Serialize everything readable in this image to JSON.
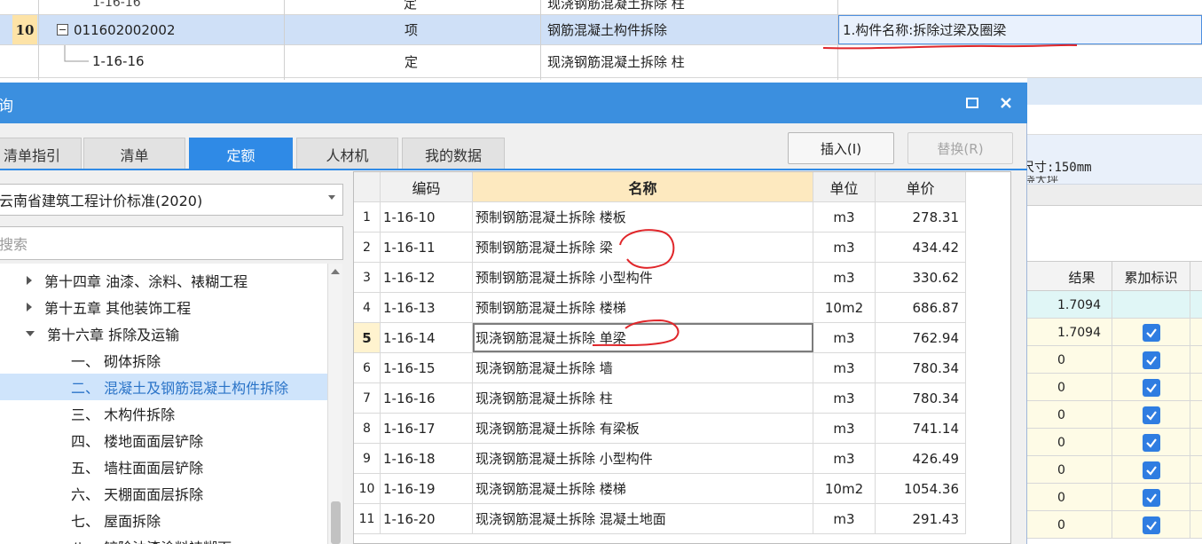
{
  "background_sheet": {
    "row_cut": {
      "code": "1-16-16",
      "type": "定",
      "name": "现浇钢筋混凝土拆除 柱"
    },
    "row_10": {
      "num": "10",
      "code": "011602002002",
      "type": "项",
      "name": "钢筋混凝土构件拆除",
      "feature": "1.构件名称:拆除过梁及圈梁"
    },
    "row_sub": {
      "code": "1-16-16",
      "type": "定",
      "name": "现浇钢筋混凝土拆除 柱"
    },
    "side_text": "尺寸:150mm",
    "side_text_cut": "浇大坪",
    "result_headers": [
      "结果",
      "累加标识"
    ],
    "result_rows": [
      {
        "result": "1.7094",
        "checked": false
      },
      {
        "result": "1.7094",
        "checked": true
      },
      {
        "result": "0",
        "checked": true
      },
      {
        "result": "0",
        "checked": true
      },
      {
        "result": "0",
        "checked": true
      },
      {
        "result": "0",
        "checked": true
      },
      {
        "result": "0",
        "checked": true
      },
      {
        "result": "0",
        "checked": true
      },
      {
        "result": "0",
        "checked": true
      }
    ]
  },
  "dialog": {
    "title": "询",
    "tabs": [
      "清单指引",
      "清单",
      "定额",
      "人材机",
      "我的数据"
    ],
    "active_tab": "定额",
    "buttons": {
      "insert": "插入(I)",
      "replace": "替换(R)"
    },
    "standard_select": "云南省建筑工程计价标准(2020)",
    "search_placeholder": "搜索",
    "tree": [
      {
        "label": "第十四章 油漆、涂料、裱糊工程",
        "state": "collapsed"
      },
      {
        "label": "第十五章 其他装饰工程",
        "state": "collapsed"
      },
      {
        "label": "第十六章 拆除及运输",
        "state": "expanded"
      },
      {
        "label": "一、 砌体拆除"
      },
      {
        "label": "二、 混凝土及钢筋混凝土构件拆除",
        "selected": true
      },
      {
        "label": "三、 木构件拆除"
      },
      {
        "label": "四、 楼地面面层铲除"
      },
      {
        "label": "五、 墙柱面面层铲除"
      },
      {
        "label": "六、 天棚面面层拆除"
      },
      {
        "label": "七、 屋面拆除"
      },
      {
        "label": "八、 铲除油漆涂料裱糊面"
      }
    ],
    "grid": {
      "headers": {
        "code": "编码",
        "name": "名称",
        "unit": "单位",
        "price": "单价"
      },
      "rows": [
        {
          "num": "1",
          "code": "1-16-10",
          "name": "预制钢筋混凝土拆除 楼板",
          "unit": "m3",
          "price": "278.31"
        },
        {
          "num": "2",
          "code": "1-16-11",
          "name": "预制钢筋混凝土拆除 梁",
          "unit": "m3",
          "price": "434.42"
        },
        {
          "num": "3",
          "code": "1-16-12",
          "name": "预制钢筋混凝土拆除 小型构件",
          "unit": "m3",
          "price": "330.62"
        },
        {
          "num": "4",
          "code": "1-16-13",
          "name": "预制钢筋混凝土拆除 楼梯",
          "unit": "10m2",
          "price": "686.87"
        },
        {
          "num": "5",
          "code": "1-16-14",
          "name": "现浇钢筋混凝土拆除 单梁",
          "unit": "m3",
          "price": "762.94",
          "current": true
        },
        {
          "num": "6",
          "code": "1-16-15",
          "name": "现浇钢筋混凝土拆除 墙",
          "unit": "m3",
          "price": "780.34"
        },
        {
          "num": "7",
          "code": "1-16-16",
          "name": "现浇钢筋混凝土拆除 柱",
          "unit": "m3",
          "price": "780.34"
        },
        {
          "num": "8",
          "code": "1-16-17",
          "name": "现浇钢筋混凝土拆除 有梁板",
          "unit": "m3",
          "price": "741.14"
        },
        {
          "num": "9",
          "code": "1-16-18",
          "name": "现浇钢筋混凝土拆除 小型构件",
          "unit": "m3",
          "price": "426.49"
        },
        {
          "num": "10",
          "code": "1-16-19",
          "name": "现浇钢筋混凝土拆除 楼梯",
          "unit": "10m2",
          "price": "1054.36"
        },
        {
          "num": "11",
          "code": "1-16-20",
          "name": "现浇钢筋混凝土拆除 混凝土地面",
          "unit": "m3",
          "price": "291.43"
        }
      ]
    }
  },
  "colors": {
    "titlebar": "#3b8fdf",
    "active_tab": "#2f8ae6",
    "selection": "#cfe4fb",
    "name_header": "#fde9bf",
    "annotation": "#e0262a",
    "checkbox": "#2f7de1"
  }
}
